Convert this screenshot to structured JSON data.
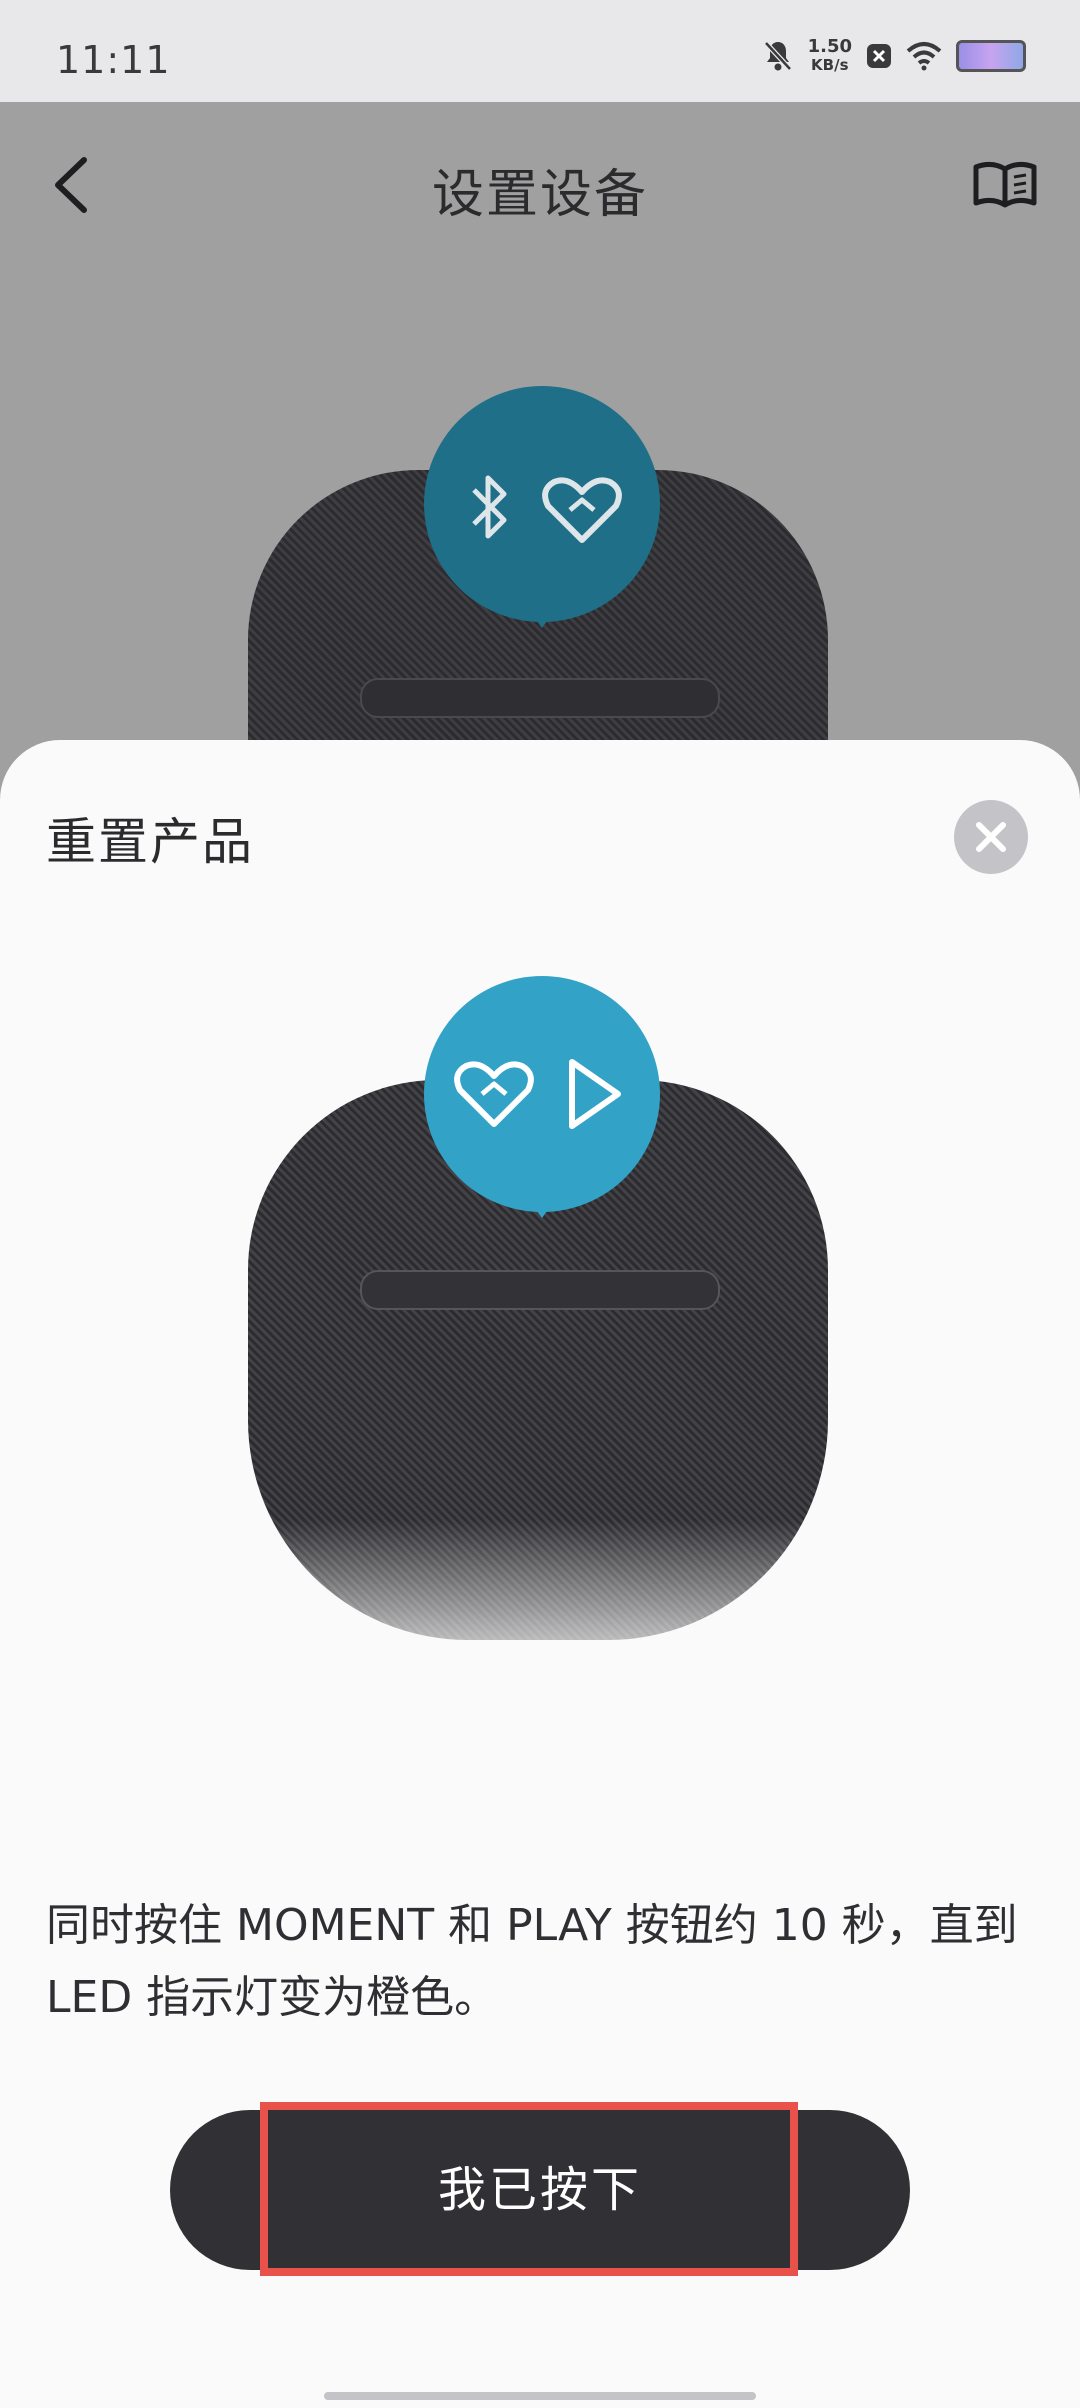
{
  "status_bar": {
    "time": "11:11",
    "net_speed_value": "1.50",
    "net_speed_unit": "KB/s",
    "icons": [
      "mute-bell-icon",
      "close-box-icon",
      "wifi-icon",
      "battery-icon"
    ]
  },
  "header": {
    "title": "设置设备",
    "back_icon": "chevron-left-icon",
    "guide_icon": "book-icon"
  },
  "sheet": {
    "title": "重置产品",
    "close_icon": "close-icon",
    "illustration": {
      "bubble_icons": [
        "heart-icon",
        "play-icon"
      ],
      "bubble_color": "#32a3c6"
    },
    "instruction": "同时按住 MOMENT 和 PLAY 按钮约 10 秒，直到 LED 指示灯变为橙色。",
    "confirm_button": "我已按下"
  },
  "background_illustration": {
    "bubble_icons": [
      "bluetooth-icon",
      "heart-icon"
    ],
    "bubble_color": "#1f6f88"
  },
  "colors": {
    "button_bg": "#313135",
    "highlight": "#e8524a",
    "sheet_bg": "#fafafa",
    "overlay_bg": "#a0a0a0"
  }
}
